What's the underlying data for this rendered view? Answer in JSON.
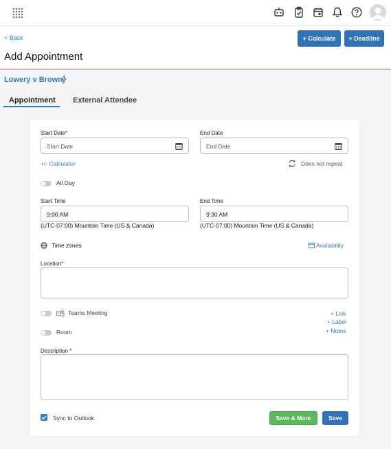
{
  "header": {
    "back_label": "< Back",
    "title": "Add Appointment",
    "calculate_label": "+ Calculate",
    "deadline_label": "+ Deadline"
  },
  "matter": {
    "name": "Lowery v Brown"
  },
  "tabs": [
    {
      "label": "Appointment",
      "active": true
    },
    {
      "label": "External Attendee",
      "active": false
    }
  ],
  "form": {
    "start_date": {
      "label": "Start Date*",
      "placeholder": "Start Date",
      "value": ""
    },
    "end_date": {
      "label": "End Date",
      "placeholder": "End Date",
      "value": ""
    },
    "calculator_link": "+/- Calculator",
    "repeat_label": "Does not repeat",
    "all_day": {
      "label": "All Day",
      "on": false
    },
    "start_time": {
      "label": "Start Time",
      "value": "9:00 AM",
      "timezone": "(UTC-07:00) Mountain Time (US & Canada)"
    },
    "end_time": {
      "label": "End Time",
      "value": "9:30 AM",
      "timezone": "(UTC-07:00) Mountain Time (US & Canada)"
    },
    "time_zones_label": "Time zones",
    "availability_link": "Availability",
    "location": {
      "label": "Location*",
      "value": ""
    },
    "teams_meeting": {
      "label": "Teams Meeting",
      "on": false
    },
    "room": {
      "label": "Room",
      "on": false
    },
    "extra_links": [
      "+ Link",
      "+ Label",
      "+ Notes"
    ],
    "description": {
      "label": "Description *",
      "value": ""
    },
    "sync_outlook": {
      "label": "Sync to Outlook",
      "checked": true
    },
    "save_more_label": "Save & More",
    "save_label": "Save"
  },
  "colors": {
    "accent": "#2e7cc2",
    "primary_button": "#3273b8",
    "success_button": "#5cb85c",
    "header_rule": "#d9534f"
  }
}
